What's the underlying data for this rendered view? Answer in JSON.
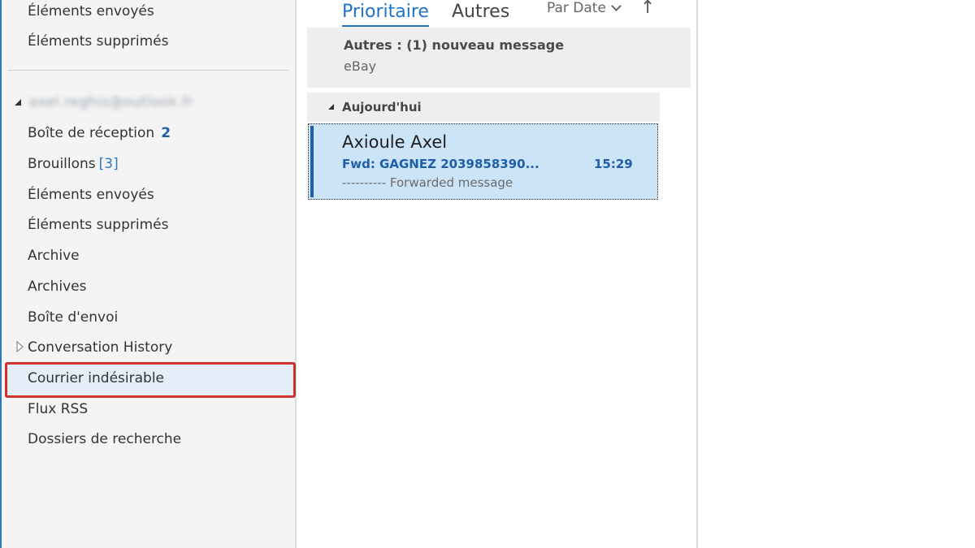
{
  "folder_pane": {
    "top_folders": [
      {
        "label": "Éléments envoyés"
      },
      {
        "label": "Éléments supprimés"
      }
    ],
    "account": {
      "email": "axel.reghis@outlook.fr",
      "expanded": true
    },
    "folders": [
      {
        "label": "Boîte de réception",
        "count": "2",
        "count_style": "bold"
      },
      {
        "label": "Brouillons",
        "count": "[3]",
        "count_style": "bracket"
      },
      {
        "label": "Éléments envoyés"
      },
      {
        "label": "Éléments supprimés"
      },
      {
        "label": "Archive"
      },
      {
        "label": "Archives"
      },
      {
        "label": "Boîte d'envoi"
      },
      {
        "label": "Conversation History",
        "collapsed": true
      },
      {
        "label": "Courrier indésirable",
        "highlighted": true
      },
      {
        "label": "Flux RSS"
      },
      {
        "label": "Dossiers de recherche"
      }
    ]
  },
  "message_list": {
    "tabs": [
      {
        "label": "Prioritaire",
        "active": true
      },
      {
        "label": "Autres",
        "active": false
      }
    ],
    "sort": {
      "label": "Par Date",
      "direction_icon": "arrow-up-icon"
    },
    "others_banner": {
      "title": "Autres : (1) nouveau message",
      "sender": "eBay"
    },
    "groups": [
      {
        "label": "Aujourd'hui",
        "messages": [
          {
            "sender": "Axioule Axel",
            "subject": "Fwd: GAGNEZ 2039858390...",
            "time": "15:29",
            "preview": "---------- Forwarded message",
            "selected": true,
            "unread": true
          }
        ]
      }
    ]
  },
  "colors": {
    "accent": "#1e73c7",
    "unread": "#1f5fa8",
    "selection": "#cce4f7",
    "highlight_box": "#d0302a"
  }
}
